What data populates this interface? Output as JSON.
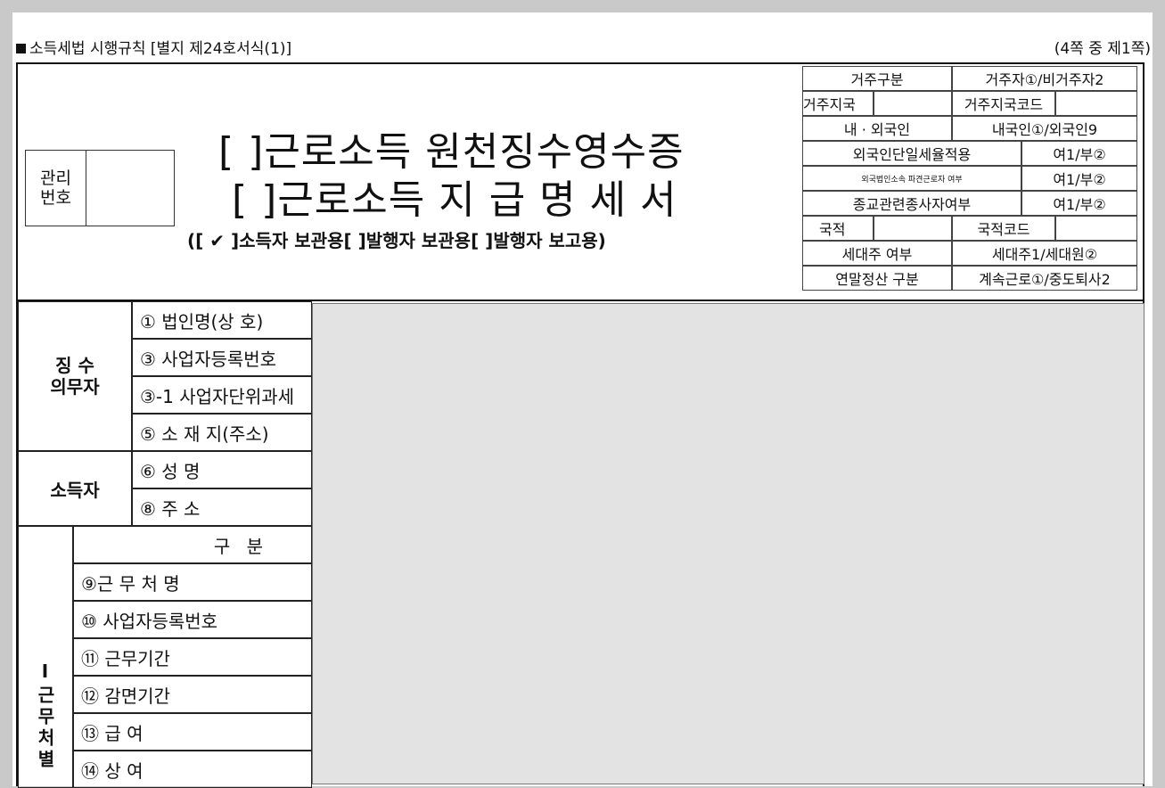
{
  "header": {
    "form_title": "소득세법 시행규칙 [별지 제24호서식(1)]",
    "page_indicator": "(4쪽 중 제1쪽)"
  },
  "management": {
    "label": "관리\n번호",
    "value": ""
  },
  "title": {
    "line1": "[  ]근로소득 원천징수영수증",
    "line2": "[  ]근로소득 지 급 명 세 서",
    "subtitle": "([ ✔ ]소득자 보관용[     ]발행자 보관용[     ]발행자 보고용)"
  },
  "info_grid": {
    "residency_label": "거주구분",
    "residency_value": "거주자①/비거주자2",
    "residence_country_label": "거주지국",
    "residence_country_code_label": "거주지국코드",
    "nationality_type_label": "내 · 외국인",
    "nationality_type_value": "내국인①/외국인9",
    "flat_tax_label": "외국인단일세율적용",
    "flat_tax_value": "여1/부②",
    "foreign_corp_label": "외국법인소속 파견근로자 여부",
    "foreign_corp_value": "여1/부②",
    "religious_label": "종교관련종사자여부",
    "religious_value": "여1/부②",
    "country_label": "국적",
    "country_code_label": "국적코드",
    "household_label": "세대주 여부",
    "household_value": "세대주1/세대원②",
    "settlement_label": "연말정산 구분",
    "settlement_value": "계속근로①/중도퇴사2"
  },
  "withholder": {
    "section_label": "징 수\n의무자",
    "rows": [
      "① 법인명(상  호)",
      "③ 사업자등록번호",
      "③-1 사업자단위과세",
      "⑤ 소 재 지(주소)"
    ]
  },
  "earner": {
    "section_label": "소득자",
    "rows": [
      "⑥ 성        명",
      "⑧ 주        소"
    ]
  },
  "workplace": {
    "section_label": "Ⅰ근무처별",
    "header": "구 분",
    "rows": [
      "⑨근 무 처 명",
      "⑩ 사업자등록번호",
      "⑪ 근무기간",
      "⑫ 감면기간",
      "⑬ 급        여",
      "⑭ 상        여"
    ]
  }
}
